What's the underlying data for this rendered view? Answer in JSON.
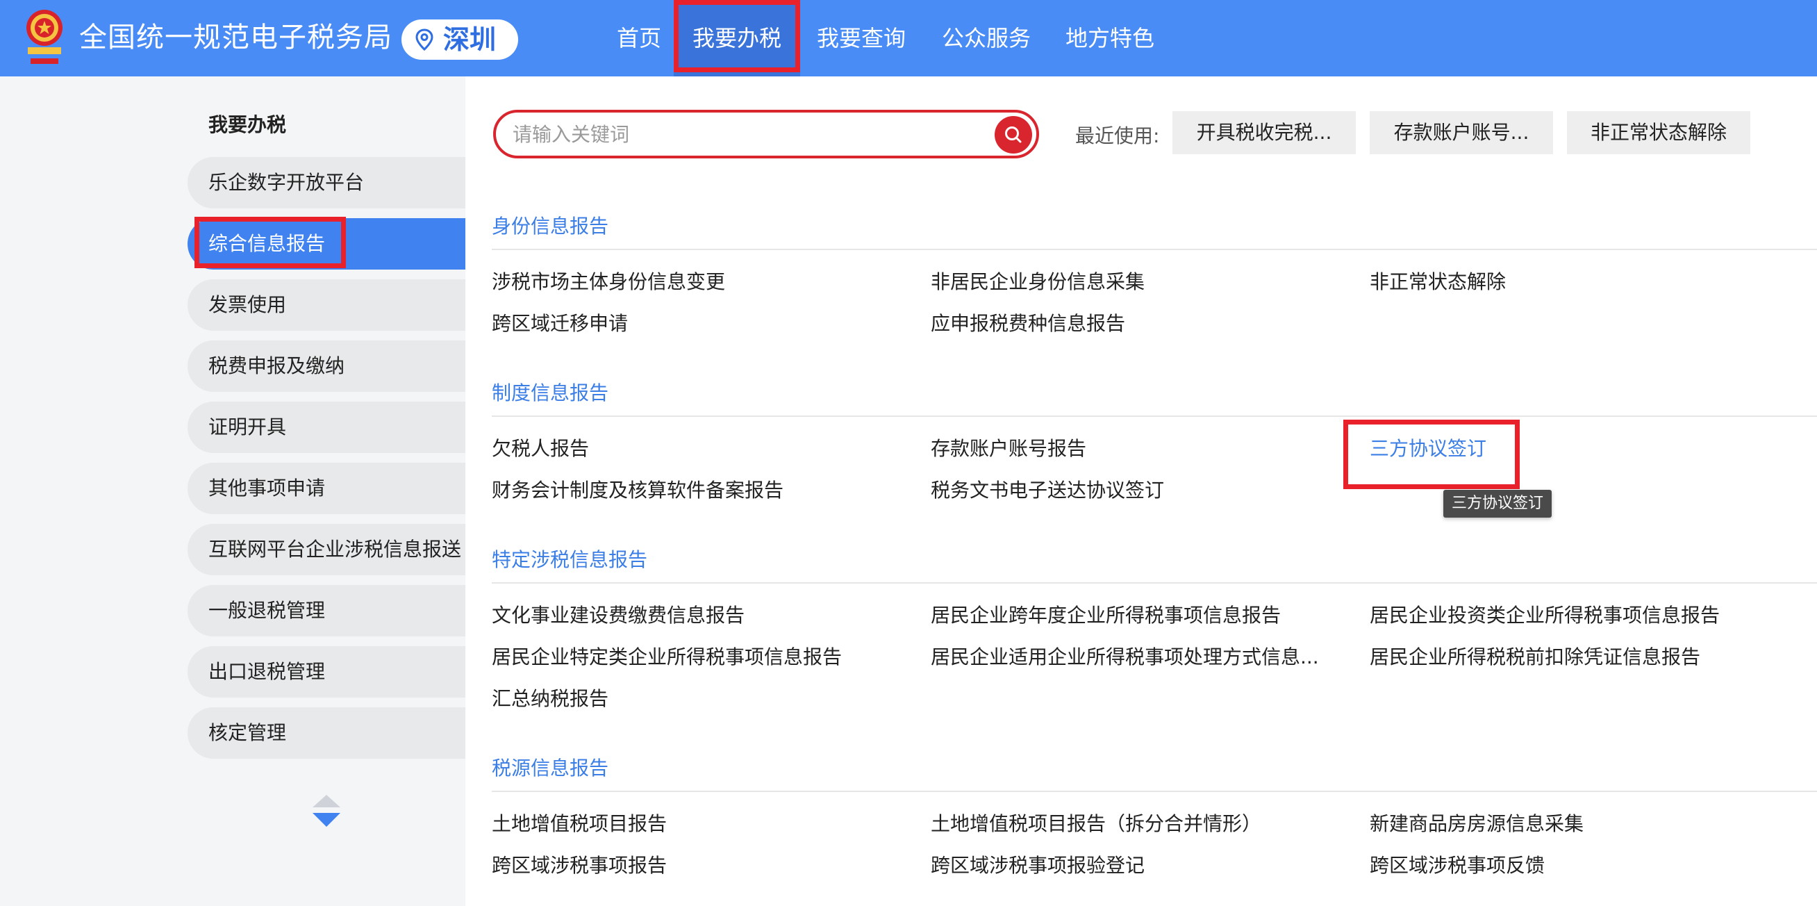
{
  "header": {
    "site_title": "全国统一规范电子税务局",
    "city": "深圳",
    "nav": [
      "首页",
      "我要办税",
      "我要查询",
      "公众服务",
      "地方特色"
    ]
  },
  "sidebar": {
    "title": "我要办税",
    "items": [
      "乐企数字开放平台",
      "综合信息报告",
      "发票使用",
      "税费申报及缴纳",
      "证明开具",
      "其他事项申请",
      "互联网平台企业涉税信息报送",
      "一般退税管理",
      "出口退税管理",
      "核定管理"
    ],
    "active_index": 1
  },
  "search": {
    "placeholder": "请输入关键词",
    "value": ""
  },
  "recent": {
    "label": "最近使用:",
    "items": [
      "开具税收完税...",
      "存款账户账号...",
      "非正常状态解除"
    ]
  },
  "sections": [
    {
      "title": "身份信息报告",
      "links": [
        "涉税市场主体身份信息变更",
        "非居民企业身份信息采集",
        "非正常状态解除",
        "跨区域迁移申请",
        "应申报税费种信息报告"
      ]
    },
    {
      "title": "制度信息报告",
      "links": [
        "欠税人报告",
        "存款账户账号报告",
        "三方协议签订",
        "财务会计制度及核算软件备案报告",
        "税务文书电子送达协议签订"
      ]
    },
    {
      "title": "特定涉税信息报告",
      "links": [
        "文化事业建设费缴费信息报告",
        "居民企业跨年度企业所得税事项信息报告",
        "居民企业投资类企业所得税事项信息报告",
        "居民企业特定类企业所得税事项信息报告",
        "居民企业适用企业所得税事项处理方式信息...",
        "居民企业所得税税前扣除凭证信息报告",
        "汇总纳税报告"
      ]
    },
    {
      "title": "税源信息报告",
      "links": [
        "土地增值税项目报告",
        "土地增值税项目报告（拆分合并情形）",
        "新建商品房房源信息采集",
        "跨区域涉税事项报告",
        "跨区域涉税事项报验登记",
        "跨区域涉税事项反馈"
      ]
    }
  ],
  "tooltip": "三方协议签订",
  "colors": {
    "header_bg": "#4a8cf5",
    "nav_active": "#3a74da",
    "accent_blue": "#3a7ee6",
    "sidebar_active": "#3f82f0",
    "annotation_red": "#e8212a",
    "search_red": "#d9262e"
  }
}
